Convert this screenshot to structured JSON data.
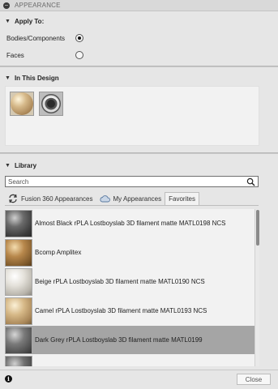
{
  "panel": {
    "title": "APPEARANCE"
  },
  "apply_to": {
    "heading": "Apply To:",
    "options": [
      {
        "label": "Bodies/Components",
        "selected": true
      },
      {
        "label": "Faces",
        "selected": false
      }
    ]
  },
  "in_design": {
    "heading": "In This Design",
    "swatches": [
      {
        "icon": "beige-plastic-swatch-icon",
        "color": "#c9ae7c"
      },
      {
        "icon": "chrome-swatch-icon",
        "color": "#3f3f3f"
      }
    ]
  },
  "library": {
    "heading": "Library",
    "search_placeholder": "Search",
    "tabs": [
      {
        "label": "Fusion 360 Appearances",
        "icon": "refresh-icon"
      },
      {
        "label": "My Appearances",
        "icon": "cloud-icon"
      },
      {
        "label": "Favorites",
        "active": true
      }
    ],
    "items": [
      {
        "name": "Almost Black rPLA Lostboyslab 3D filament matte MATL0198 NCS",
        "color": "#5a5a5a",
        "selected": false
      },
      {
        "name": "Bcomp Amplitex",
        "color": "#a67b44",
        "selected": false
      },
      {
        "name": "Beige rPLA Lostboyslab 3D filament matte MATL0190 NCS",
        "color": "#d9d6cf",
        "selected": false
      },
      {
        "name": "Camel rPLA Lostboyslab 3D filament matte MATL0193 NCS",
        "color": "#c8a97b",
        "selected": false
      },
      {
        "name": "Dark Grey rPLA Lostboyslab 3D filament matte MATL0199",
        "color": "#707070",
        "selected": true
      },
      {
        "name": "",
        "color": "#6a6a6a",
        "selected": false
      }
    ]
  },
  "footer": {
    "info_glyph": "i",
    "close_label": "Close"
  },
  "colors": {
    "panel_bg": "#e6e6e6",
    "list_bg": "#f2f2f2",
    "selected_row": "#a5a5a5"
  }
}
